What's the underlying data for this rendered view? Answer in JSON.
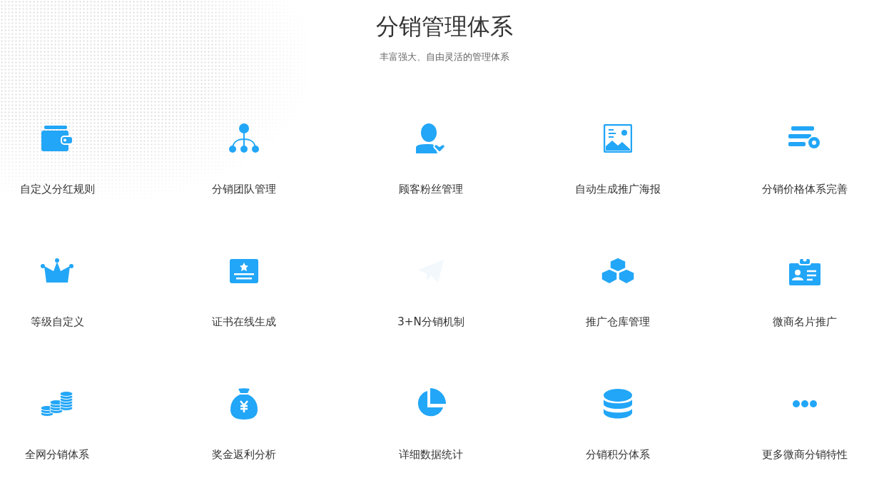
{
  "title": "分销管理体系",
  "subtitle": "丰富强大、自由灵活的管理体系",
  "features": [
    {
      "label": "自定义分红规则"
    },
    {
      "label": "分销团队管理"
    },
    {
      "label": "顾客粉丝管理"
    },
    {
      "label": "自动生成推广海报"
    },
    {
      "label": "分销价格体系完善"
    },
    {
      "label": "等级自定义"
    },
    {
      "label": "证书在线生成"
    },
    {
      "label": "3+N分销机制"
    },
    {
      "label": "推广仓库管理"
    },
    {
      "label": "微商名片推广"
    },
    {
      "label": "全网分销体系"
    },
    {
      "label": "奖金返利分析"
    },
    {
      "label": "详细数据统计"
    },
    {
      "label": "分销积分体系"
    },
    {
      "label": "更多微商分销特性"
    }
  ]
}
